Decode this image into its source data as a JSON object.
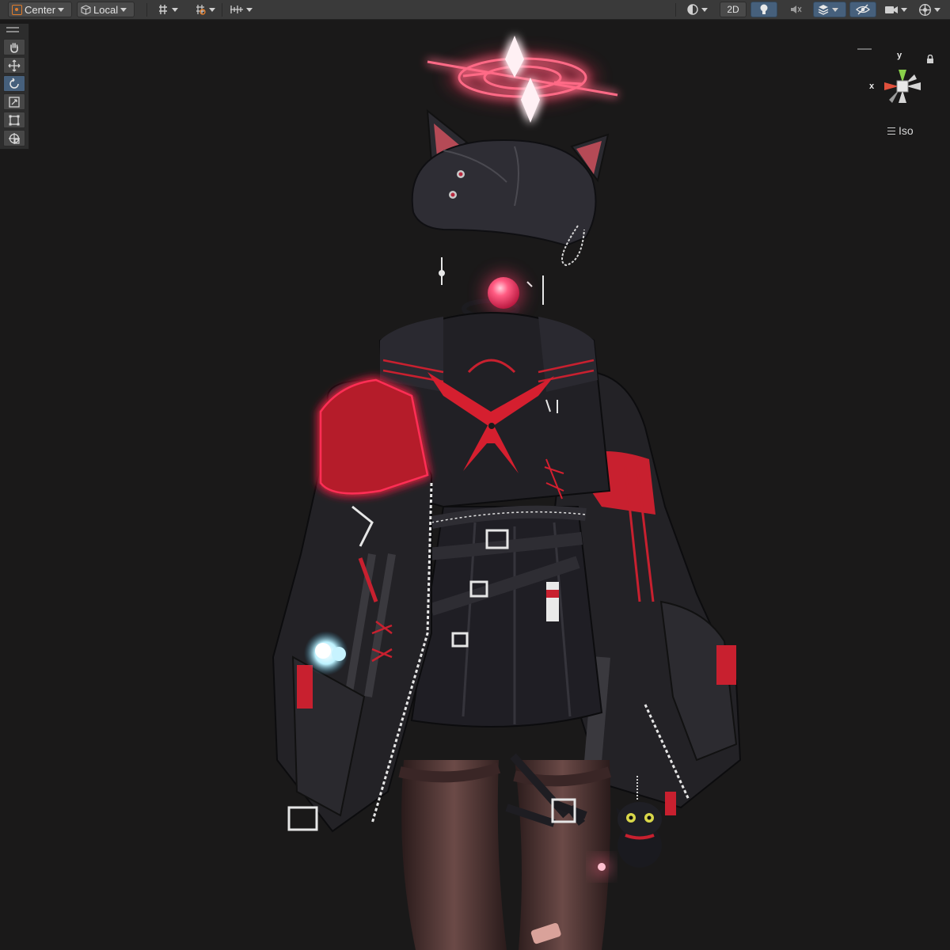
{
  "toolbar": {
    "pivot_mode": "Center",
    "pivot_rotation": "Local",
    "mode_2d": "2D"
  },
  "scene_gizmo": {
    "axis_y": "y",
    "axis_x": "x",
    "projection": "Iso",
    "colors": {
      "x": "#e0503c",
      "y": "#8ad14a",
      "z": "#d6d6d6"
    }
  },
  "tools": [
    {
      "name": "hand-tool",
      "icon": "hand-icon"
    },
    {
      "name": "move-tool",
      "icon": "move-icon"
    },
    {
      "name": "rotate-tool",
      "icon": "rotate-icon",
      "active": true
    },
    {
      "name": "scale-tool",
      "icon": "scale-icon"
    },
    {
      "name": "rect-tool",
      "icon": "rect-transform-icon"
    },
    {
      "name": "transform-tool",
      "icon": "transform-icon"
    }
  ],
  "colors": {
    "viewport_bg": "#1a1919",
    "toolbar_bg": "#3a3a3a",
    "active_button": "#46607c",
    "neon_red": "#ff2e55"
  }
}
